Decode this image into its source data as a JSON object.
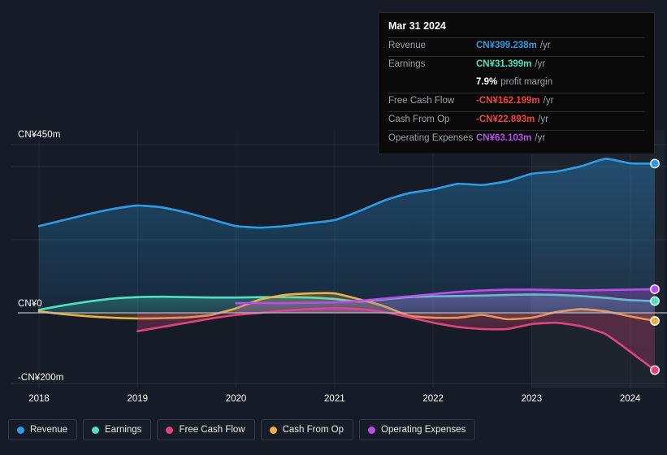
{
  "chart_data": {
    "type": "area",
    "title": "",
    "xlabel": "",
    "ylabel": "",
    "currency": "CN¥",
    "xlim": [
      2017.75,
      2024.35
    ],
    "ylim": [
      -200,
      450
    ],
    "grid": true,
    "legend_position": "bottom",
    "x_ticks": [
      "2018",
      "2019",
      "2020",
      "2021",
      "2022",
      "2023",
      "2024"
    ],
    "x_tick_values": [
      2018,
      2019,
      2020,
      2021,
      2022,
      2023,
      2024
    ],
    "y_ticks": [
      "CN¥450m",
      "CN¥0",
      "-CN¥200m"
    ],
    "y_tick_values": [
      450,
      0,
      -200
    ],
    "zero_line": 0,
    "highlight_band": {
      "from": 2023.0,
      "to": 2024.35
    },
    "series": [
      {
        "name": "Revenue",
        "color": "#2E9BE6",
        "x": [
          2018.0,
          2018.25,
          2018.5,
          2018.75,
          2019.0,
          2019.25,
          2019.5,
          2019.75,
          2020.0,
          2020.25,
          2020.5,
          2020.75,
          2021.0,
          2021.25,
          2021.5,
          2021.75,
          2022.0,
          2022.25,
          2022.5,
          2022.75,
          2023.0,
          2023.25,
          2023.5,
          2023.75,
          2024.0,
          2024.25
        ],
        "values": [
          232,
          248,
          264,
          278,
          287,
          282,
          268,
          250,
          232,
          228,
          232,
          240,
          248,
          272,
          300,
          320,
          330,
          345,
          342,
          352,
          372,
          378,
          392,
          412,
          400,
          399.238
        ]
      },
      {
        "name": "Earnings",
        "color": "#4FE0C4",
        "x": [
          2018.0,
          2018.25,
          2018.5,
          2018.75,
          2019.0,
          2019.25,
          2019.5,
          2019.75,
          2020.0,
          2020.25,
          2020.5,
          2020.75,
          2021.0,
          2021.25,
          2021.5,
          2021.75,
          2022.0,
          2022.25,
          2022.5,
          2022.75,
          2023.0,
          2023.25,
          2023.5,
          2023.75,
          2024.0,
          2024.25
        ],
        "values": [
          8,
          20,
          30,
          38,
          42,
          43,
          42,
          41,
          41,
          42,
          42,
          41,
          37,
          30,
          36,
          42,
          44,
          45,
          46,
          48,
          49,
          48,
          45,
          40,
          34,
          31.399
        ]
      },
      {
        "name": "Free Cash Flow",
        "color": "#E0437E",
        "x": [
          2019.0,
          2019.25,
          2019.5,
          2019.75,
          2020.0,
          2020.25,
          2020.5,
          2020.75,
          2021.0,
          2021.25,
          2021.5,
          2021.75,
          2022.0,
          2022.25,
          2022.5,
          2022.75,
          2023.0,
          2023.25,
          2023.5,
          2023.75,
          2024.0,
          2024.25
        ],
        "values": [
          -52,
          -40,
          -28,
          -16,
          -6,
          0,
          6,
          10,
          12,
          10,
          2,
          -12,
          -28,
          -40,
          -46,
          -46,
          -32,
          -28,
          -38,
          -60,
          -110,
          -162.199
        ]
      },
      {
        "name": "Cash From Op",
        "color": "#E8B04B",
        "x": [
          2018.0,
          2018.25,
          2018.5,
          2018.75,
          2019.0,
          2019.25,
          2019.5,
          2019.75,
          2020.0,
          2020.25,
          2020.5,
          2020.75,
          2021.0,
          2021.25,
          2021.5,
          2021.75,
          2022.0,
          2022.25,
          2022.5,
          2022.75,
          2023.0,
          2023.25,
          2023.5,
          2023.75,
          2024.0,
          2024.25
        ],
        "values": [
          4,
          -4,
          -10,
          -14,
          -16,
          -15,
          -13,
          -6,
          12,
          36,
          48,
          52,
          52,
          36,
          18,
          -8,
          -14,
          -14,
          -6,
          -18,
          -14,
          2,
          10,
          4,
          -10,
          -22.893
        ]
      },
      {
        "name": "Operating Expenses",
        "color": "#B84FE8",
        "x": [
          2020.0,
          2020.25,
          2020.5,
          2020.75,
          2021.0,
          2021.25,
          2021.5,
          2021.75,
          2022.0,
          2022.25,
          2022.5,
          2022.75,
          2023.0,
          2023.25,
          2023.5,
          2023.75,
          2024.0,
          2024.25
        ],
        "values": [
          26,
          26,
          26,
          27,
          28,
          32,
          38,
          44,
          50,
          56,
          60,
          62,
          62,
          61,
          60,
          61,
          62,
          63.103
        ]
      }
    ]
  },
  "tooltip": {
    "title": "Mar 31 2024",
    "rows": [
      {
        "key": "Revenue",
        "value": "CN¥399.238m",
        "unit": "/yr",
        "color": "#2E9BE6",
        "divider": true
      },
      {
        "key": "Earnings",
        "value": "CN¥31.399m",
        "unit": "/yr",
        "color": "#4FE0C4",
        "divider": true
      },
      {
        "key": "",
        "value": "7.9%",
        "unit": "profit margin",
        "color": "#ffffff",
        "divider": false
      },
      {
        "key": "Free Cash Flow",
        "value": "-CN¥162.199m",
        "unit": "/yr",
        "color": "#F0453A",
        "divider": true
      },
      {
        "key": "Cash From Op",
        "value": "-CN¥22.893m",
        "unit": "/yr",
        "color": "#F0453A",
        "divider": true
      },
      {
        "key": "Operating Expenses",
        "value": "CN¥63.103m",
        "unit": "/yr",
        "color": "#B84FE8",
        "divider": true
      }
    ]
  },
  "legend": {
    "items": [
      {
        "label": "Revenue",
        "color": "#2E9BE6"
      },
      {
        "label": "Earnings",
        "color": "#4FE0C4"
      },
      {
        "label": "Free Cash Flow",
        "color": "#E0437E"
      },
      {
        "label": "Cash From Op",
        "color": "#E8B04B"
      },
      {
        "label": "Operating Expenses",
        "color": "#B84FE8"
      }
    ]
  },
  "colors": {
    "background": "#151c27",
    "tooltip_background": "#0a0a0a",
    "gridline": "#2b3340",
    "zero_line": "#b9bfc9",
    "axis_text": "#ffffff"
  }
}
